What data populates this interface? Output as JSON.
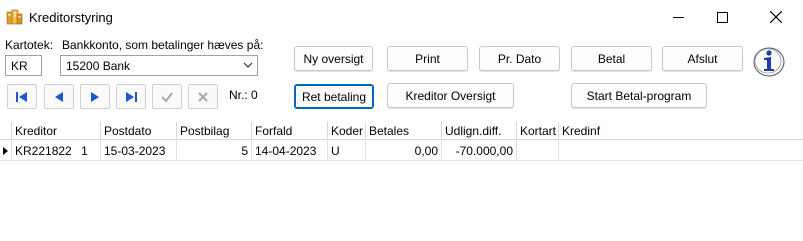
{
  "window": {
    "title": "Kreditorstyring"
  },
  "form": {
    "kartotek_label": "Kartotek:",
    "kartotek_value": "KR",
    "bankkonto_label": "Bankkonto, som betalinger hæves på:",
    "bankkonto_value": "15200  Bank",
    "nr_label": "Nr.: 0"
  },
  "buttons": {
    "ny_oversigt": "Ny oversigt",
    "print": "Print",
    "pr_dato": "Pr. Dato",
    "betal": "Betal",
    "afslut": "Afslut",
    "ret_betaling": "Ret betaling",
    "kreditor_oversigt": "Kreditor Oversigt",
    "start_betal_program": "Start Betal-program"
  },
  "grid": {
    "columns": [
      "Kreditor",
      "Postdato",
      "Postbilag",
      "Forfald",
      "Koder",
      "Betales",
      "Udlign.diff.",
      "Kortart",
      "Kredinf"
    ],
    "rows": [
      {
        "kreditor": "KR221822",
        "kreditor_nr": "1",
        "postdato": "15-03-2023",
        "postbilag": "5",
        "forfald": "14-04-2023",
        "koder": "U",
        "betales": "0,00",
        "udlign": "-70.000,00",
        "kortart": "",
        "kredinf": ""
      }
    ]
  },
  "icons": {
    "app": "app-icon",
    "minimize": "minimize-icon",
    "maximize": "maximize-icon",
    "close": "close-icon",
    "first": "first-record-icon",
    "prev": "previous-record-icon",
    "next": "next-record-icon",
    "last": "last-record-icon",
    "post": "post-check-icon",
    "cancel": "cancel-x-icon",
    "info": "info-icon",
    "row_pointer": "row-pointer-icon"
  },
  "colors": {
    "nav_blue": "#1a56d6",
    "focus_border": "#0067c0"
  }
}
